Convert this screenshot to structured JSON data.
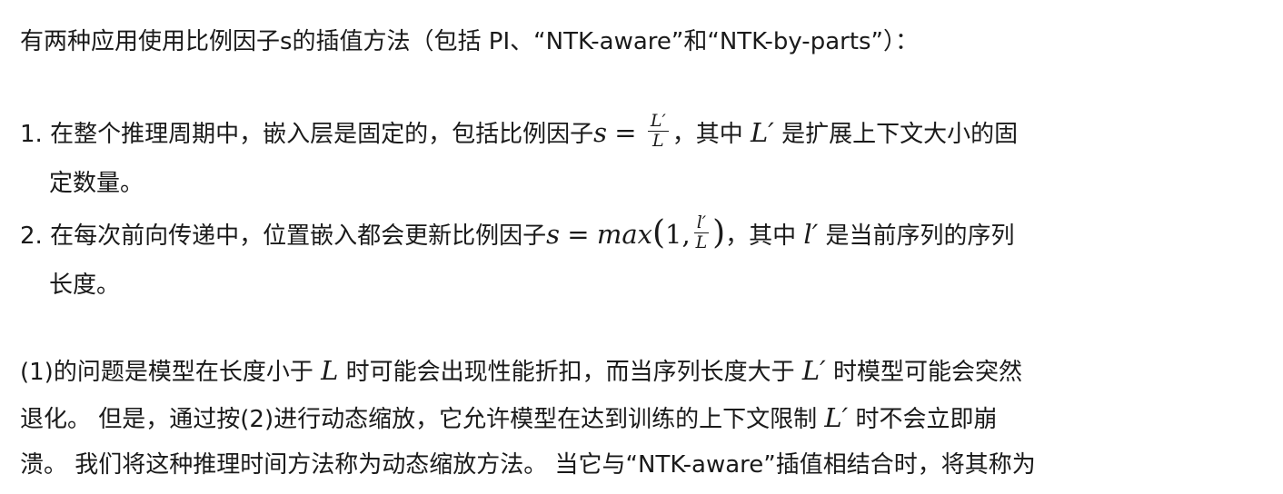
{
  "intro": "有两种应用使用比例因子s的插值方法（包括 PI、“NTK-aware”和“NTK-by-parts”）：",
  "list": [
    {
      "number": "1.",
      "text_before": "在整个推理周期中，嵌入层是固定的，包括比例因子",
      "math_s": "s",
      "math_eq": "=",
      "frac_num": "L′",
      "frac_den": "L",
      "text_mid": "，其中",
      "math_var": "L′",
      "text_after": "是扩展上下文大小的固",
      "continuation": "定数量。"
    },
    {
      "number": "2.",
      "text_before": "在每次前向传递中，位置嵌入都会更新比例因子",
      "math_s": "s",
      "math_eq": "=",
      "math_func": "max",
      "math_open": "(",
      "math_one": "1,",
      "frac_num": "l′",
      "frac_den": "L",
      "math_close": ")",
      "text_mid": "，其中",
      "math_var": "l′",
      "text_after": "是当前序列的序列",
      "continuation": "长度。"
    }
  ],
  "para2": {
    "l1_a": "(1)的问题是模型在长度小于",
    "l1_m1": "L",
    "l1_b": "时可能会出现性能折扣，而当序列长度大于",
    "l1_m2": "L′",
    "l1_c": "时模型可能会突然",
    "l2_a": "退化。 但是，通过按(2)进行动态缩放，它允许模型在达到训练的上下文限制",
    "l2_m": "L′",
    "l2_b": "时不会立即崩",
    "l3": "溃。 我们将这种推理时间方法称为动态缩放方法。 当它与“NTK-aware”插值相结合时，将其称为"
  }
}
